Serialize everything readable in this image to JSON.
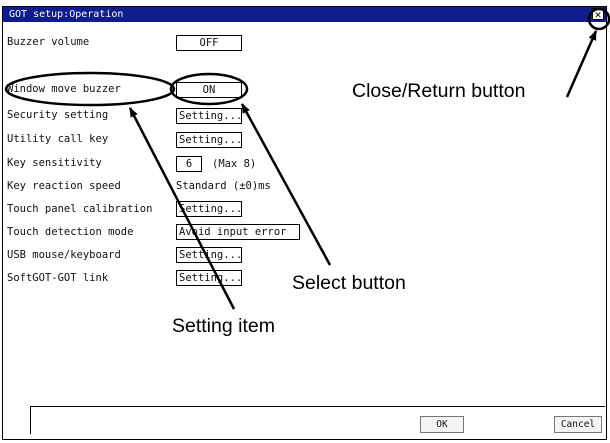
{
  "window": {
    "title": "GOT setup:Operation",
    "close_label": "✕"
  },
  "settings": {
    "buzzer_volume": {
      "label": "Buzzer volume",
      "value": "OFF"
    },
    "window_move_buzzer": {
      "label": "Window move buzzer",
      "value": "ON"
    },
    "security_setting": {
      "label": "Security setting",
      "value": "Setting..."
    },
    "utility_call_key": {
      "label": "Utility call key",
      "value": "Setting..."
    },
    "key_sensitivity": {
      "label": "Key sensitivity",
      "value": "6",
      "max_note": "(Max 8)"
    },
    "key_reaction_speed": {
      "label": "Key reaction speed",
      "value": "Standard (±0)ms"
    },
    "touch_panel_calibration": {
      "label": "Touch panel calibration",
      "value": "Setting..."
    },
    "touch_detection_mode": {
      "label": "Touch detection mode",
      "value": "Avoid input error"
    },
    "usb_mouse_keyboard": {
      "label": "USB mouse/keyboard",
      "value": "Setting..."
    },
    "softgot_got_link": {
      "label": "SoftGOT-GOT link",
      "value": "Setting..."
    }
  },
  "footer": {
    "ok_label": "OK",
    "cancel_label": "Cancel"
  },
  "callouts": {
    "close_return": "Close/Return button",
    "select_button": "Select button",
    "setting_item": "Setting item"
  },
  "colors": {
    "titlebar": "#0f1c8c",
    "background": "#ffffff"
  }
}
